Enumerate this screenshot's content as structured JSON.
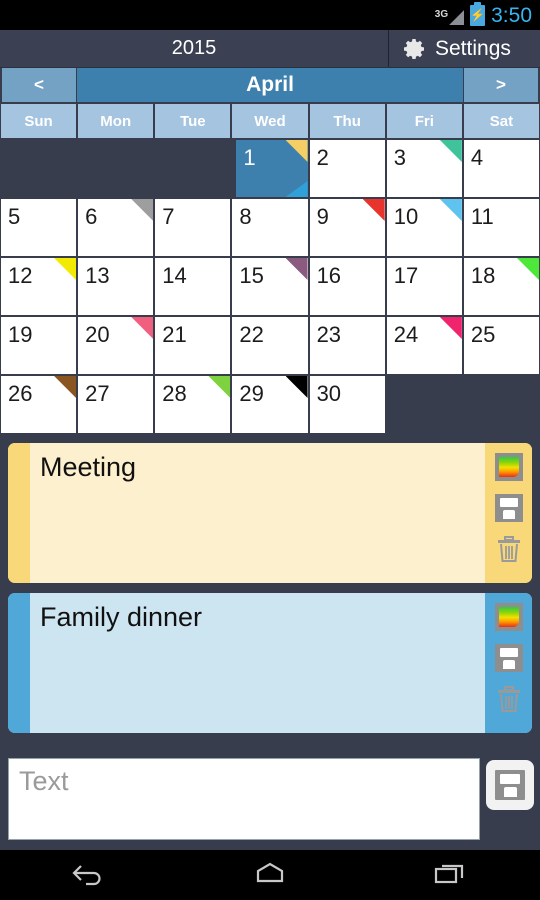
{
  "status_bar": {
    "network": "3G",
    "time": "3:50",
    "battery_icon": "battery-charging-icon",
    "signal_icon": "signal-bars-icon",
    "time_color": "#35b5f0"
  },
  "title_bar": {
    "year": "2015",
    "settings_label": "Settings",
    "settings_icon": "gear-icon"
  },
  "month_nav": {
    "prev_label": "<",
    "next_label": ">",
    "month": "April"
  },
  "weekdays": [
    "Sun",
    "Mon",
    "Tue",
    "Wed",
    "Thu",
    "Fri",
    "Sat"
  ],
  "calendar": {
    "selected_day": 1,
    "rows": [
      [
        {
          "day": "",
          "empty": true
        },
        {
          "day": "",
          "empty": true
        },
        {
          "day": "",
          "empty": true
        },
        {
          "day": "1",
          "selected": true,
          "marker": "#f5cf63",
          "marker2": "#30a0d8"
        },
        {
          "day": "2"
        },
        {
          "day": "3",
          "marker": "#3fc39a"
        },
        {
          "day": "4"
        }
      ],
      [
        {
          "day": "5"
        },
        {
          "day": "6",
          "marker": "#9e9e9e"
        },
        {
          "day": "7"
        },
        {
          "day": "8"
        },
        {
          "day": "9",
          "marker": "#e8342c"
        },
        {
          "day": "10",
          "marker": "#5fc3ef"
        },
        {
          "day": "11"
        }
      ],
      [
        {
          "day": "12",
          "marker": "#f2ea00"
        },
        {
          "day": "13"
        },
        {
          "day": "14"
        },
        {
          "day": "15",
          "marker": "#8a5b7e"
        },
        {
          "day": "16"
        },
        {
          "day": "17"
        },
        {
          "day": "18",
          "marker": "#4ee83a"
        }
      ],
      [
        {
          "day": "19"
        },
        {
          "day": "20",
          "marker": "#f0607e"
        },
        {
          "day": "21"
        },
        {
          "day": "22"
        },
        {
          "day": "23"
        },
        {
          "day": "24",
          "marker": "#f0246c"
        },
        {
          "day": "25"
        }
      ],
      [
        {
          "day": "26",
          "marker": "#8a5520"
        },
        {
          "day": "27"
        },
        {
          "day": "28",
          "marker": "#7ed23f"
        },
        {
          "day": "29",
          "marker": "#000000"
        },
        {
          "day": "30"
        },
        {
          "day": "",
          "empty": true
        },
        {
          "day": "",
          "empty": true
        }
      ]
    ]
  },
  "events": [
    {
      "title": "Meeting",
      "stripe_color": "#f8d878",
      "body_color": "#fdf0cf",
      "tools_color": "#f8d878",
      "color_button": "color-picker-icon",
      "save_button": "save-icon",
      "delete_button": "trash-icon"
    },
    {
      "title": "Family dinner",
      "stripe_color": "#4fa8d8",
      "body_color": "#cde5f0",
      "tools_color": "#4fa8d8",
      "color_button": "color-picker-icon",
      "save_button": "save-icon",
      "delete_button": "trash-icon"
    }
  ],
  "input_bar": {
    "placeholder": "Text",
    "value": "",
    "save_icon": "save-icon"
  },
  "nav_bar": {
    "back": "back-icon",
    "home": "home-icon",
    "recents": "recents-icon"
  }
}
